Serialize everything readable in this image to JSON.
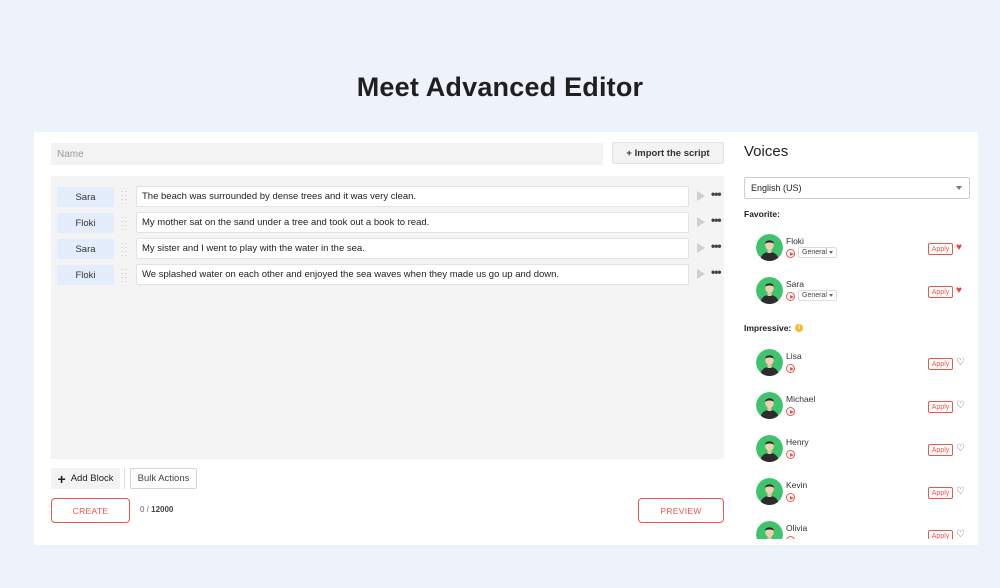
{
  "page": {
    "title": "Meet Advanced Editor"
  },
  "editor": {
    "name_placeholder": "Name",
    "import_label": "+ Import the script",
    "blocks": [
      {
        "speaker": "Sara",
        "text": "The beach was surrounded by dense trees and it was very clean."
      },
      {
        "speaker": "Floki",
        "text": "My mother sat on the sand under a tree and took out a book to read."
      },
      {
        "speaker": "Sara",
        "text": "My sister and I went to play with the water in the sea."
      },
      {
        "speaker": "Floki",
        "text": "We splashed water on each other and enjoyed the sea waves when they made us go up and down."
      }
    ],
    "add_block_label": "Add Block",
    "bulk_actions_label": "Bulk Actions",
    "create_label": "CREATE",
    "preview_label": "PREVIEW",
    "counter_used": "0",
    "counter_sep": " / ",
    "counter_max": "12000"
  },
  "voices": {
    "title": "Voices",
    "language": "English (US)",
    "favorite_label": "Favorite:",
    "impressive_label": "Impressive:",
    "apply_label": "Apply",
    "favorites": [
      {
        "name": "Floki",
        "style": "General",
        "favorited": true,
        "avatar_bg": "#3ec46d"
      },
      {
        "name": "Sara",
        "style": "General",
        "favorited": true,
        "avatar_bg": "#3ec46d"
      }
    ],
    "impressive": [
      {
        "name": "Lisa",
        "favorited": false,
        "avatar_bg": "#3ec46d"
      },
      {
        "name": "Michael",
        "favorited": false,
        "avatar_bg": "#3ec46d"
      },
      {
        "name": "Henry",
        "favorited": false,
        "avatar_bg": "#3ec46d"
      },
      {
        "name": "Kevin",
        "favorited": false,
        "avatar_bg": "#3ec46d"
      },
      {
        "name": "Olivia",
        "favorited": false,
        "avatar_bg": "#3ec46d"
      }
    ]
  },
  "colors": {
    "accent": "#e8574e",
    "speaker_bg": "#e3edfb",
    "heart": "#e8453c"
  }
}
